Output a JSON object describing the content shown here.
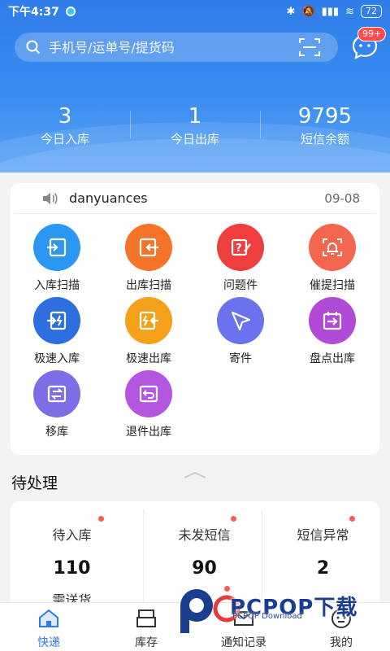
{
  "status_bar": {
    "time": "下午4:37",
    "battery": "72"
  },
  "search": {
    "placeholder": "手机号/运单号/提货码"
  },
  "messages": {
    "badge": "99+"
  },
  "stats": [
    {
      "value": "3",
      "label": "今日入库"
    },
    {
      "value": "1",
      "label": "今日出库"
    },
    {
      "value": "9795",
      "label": "短信余额"
    }
  ],
  "notice": {
    "user": "danyuances",
    "date": "09-08"
  },
  "actions": [
    {
      "label": "入库扫描",
      "icon": "scan-in-icon",
      "color": "#2b97f0"
    },
    {
      "label": "出库扫描",
      "icon": "scan-out-icon",
      "color": "#f5742a"
    },
    {
      "label": "问题件",
      "icon": "problem-parcel-icon",
      "color": "#ef3e3e"
    },
    {
      "label": "催提扫描",
      "icon": "reminder-scan-icon",
      "color": "#f4674f"
    },
    {
      "label": "极速入库",
      "icon": "fast-in-icon",
      "color": "#2e6fe0"
    },
    {
      "label": "极速出库",
      "icon": "fast-out-icon",
      "color": "#f5a019"
    },
    {
      "label": "寄件",
      "icon": "send-icon",
      "color": "#6a72ee"
    },
    {
      "label": "盘点出库",
      "icon": "inventory-out-icon",
      "color": "#b24ad8"
    },
    {
      "label": "移库",
      "icon": "move-stock-icon",
      "color": "#7d6ee8"
    },
    {
      "label": "退件出库",
      "icon": "return-out-icon",
      "color": "#b556e0"
    }
  ],
  "pending": {
    "title": "待处理",
    "items": [
      {
        "label": "待入库",
        "value": "110",
        "sub": "需送货"
      },
      {
        "label": "未发短信",
        "value": "90",
        "sub": ""
      },
      {
        "label": "短信异常",
        "value": "2",
        "sub": ""
      }
    ]
  },
  "tabs": [
    {
      "label": "快递",
      "icon": "home-icon",
      "active": true
    },
    {
      "label": "库存",
      "icon": "inventory-icon",
      "active": false
    },
    {
      "label": "通知记录",
      "icon": "notification-record-icon",
      "active": false
    },
    {
      "label": "我的",
      "icon": "profile-icon",
      "active": false
    }
  ],
  "watermark": {
    "text": "PCPOP下载",
    "sub": "PCPOP Download"
  }
}
